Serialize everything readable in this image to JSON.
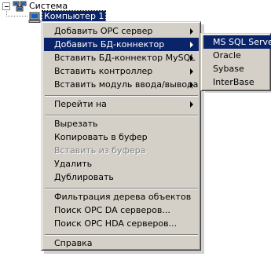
{
  "tree": {
    "root_label": "Система",
    "child_label": "Компьютер 1"
  },
  "context_menu": {
    "items": [
      {
        "label": "Добавить OPC сервер",
        "submenu": true
      },
      {
        "label": "Добавить БД-коннектор",
        "submenu": true,
        "selected": true
      },
      {
        "label": "Вставить БД-коннектор MySQL",
        "submenu": true
      },
      {
        "label": "Вставить контроллер",
        "submenu": true
      },
      {
        "label": "Вставить модуль ввода/вывода",
        "submenu": true
      },
      {
        "label": "Перейти на",
        "submenu": true
      },
      {
        "label": "Вырезать"
      },
      {
        "label": "Копировать в буфер"
      },
      {
        "label": "Вставить из буфера",
        "disabled": true
      },
      {
        "label": "Удалить"
      },
      {
        "label": "Дублировать"
      },
      {
        "label": "Фильтрация дерева объектов"
      },
      {
        "label": "Поиск OPC DA серверов..."
      },
      {
        "label": "Поиск OPC HDA серверов..."
      },
      {
        "label": "Справка"
      }
    ]
  },
  "submenu": {
    "items": [
      {
        "label": "MS SQL Server",
        "selected": true
      },
      {
        "label": "Oracle"
      },
      {
        "label": "Sybase"
      },
      {
        "label": "InterBase"
      }
    ]
  },
  "colors": {
    "menu_bg": "#d4d0c8",
    "highlight": "#0a246a",
    "disabled_text": "#808080"
  }
}
